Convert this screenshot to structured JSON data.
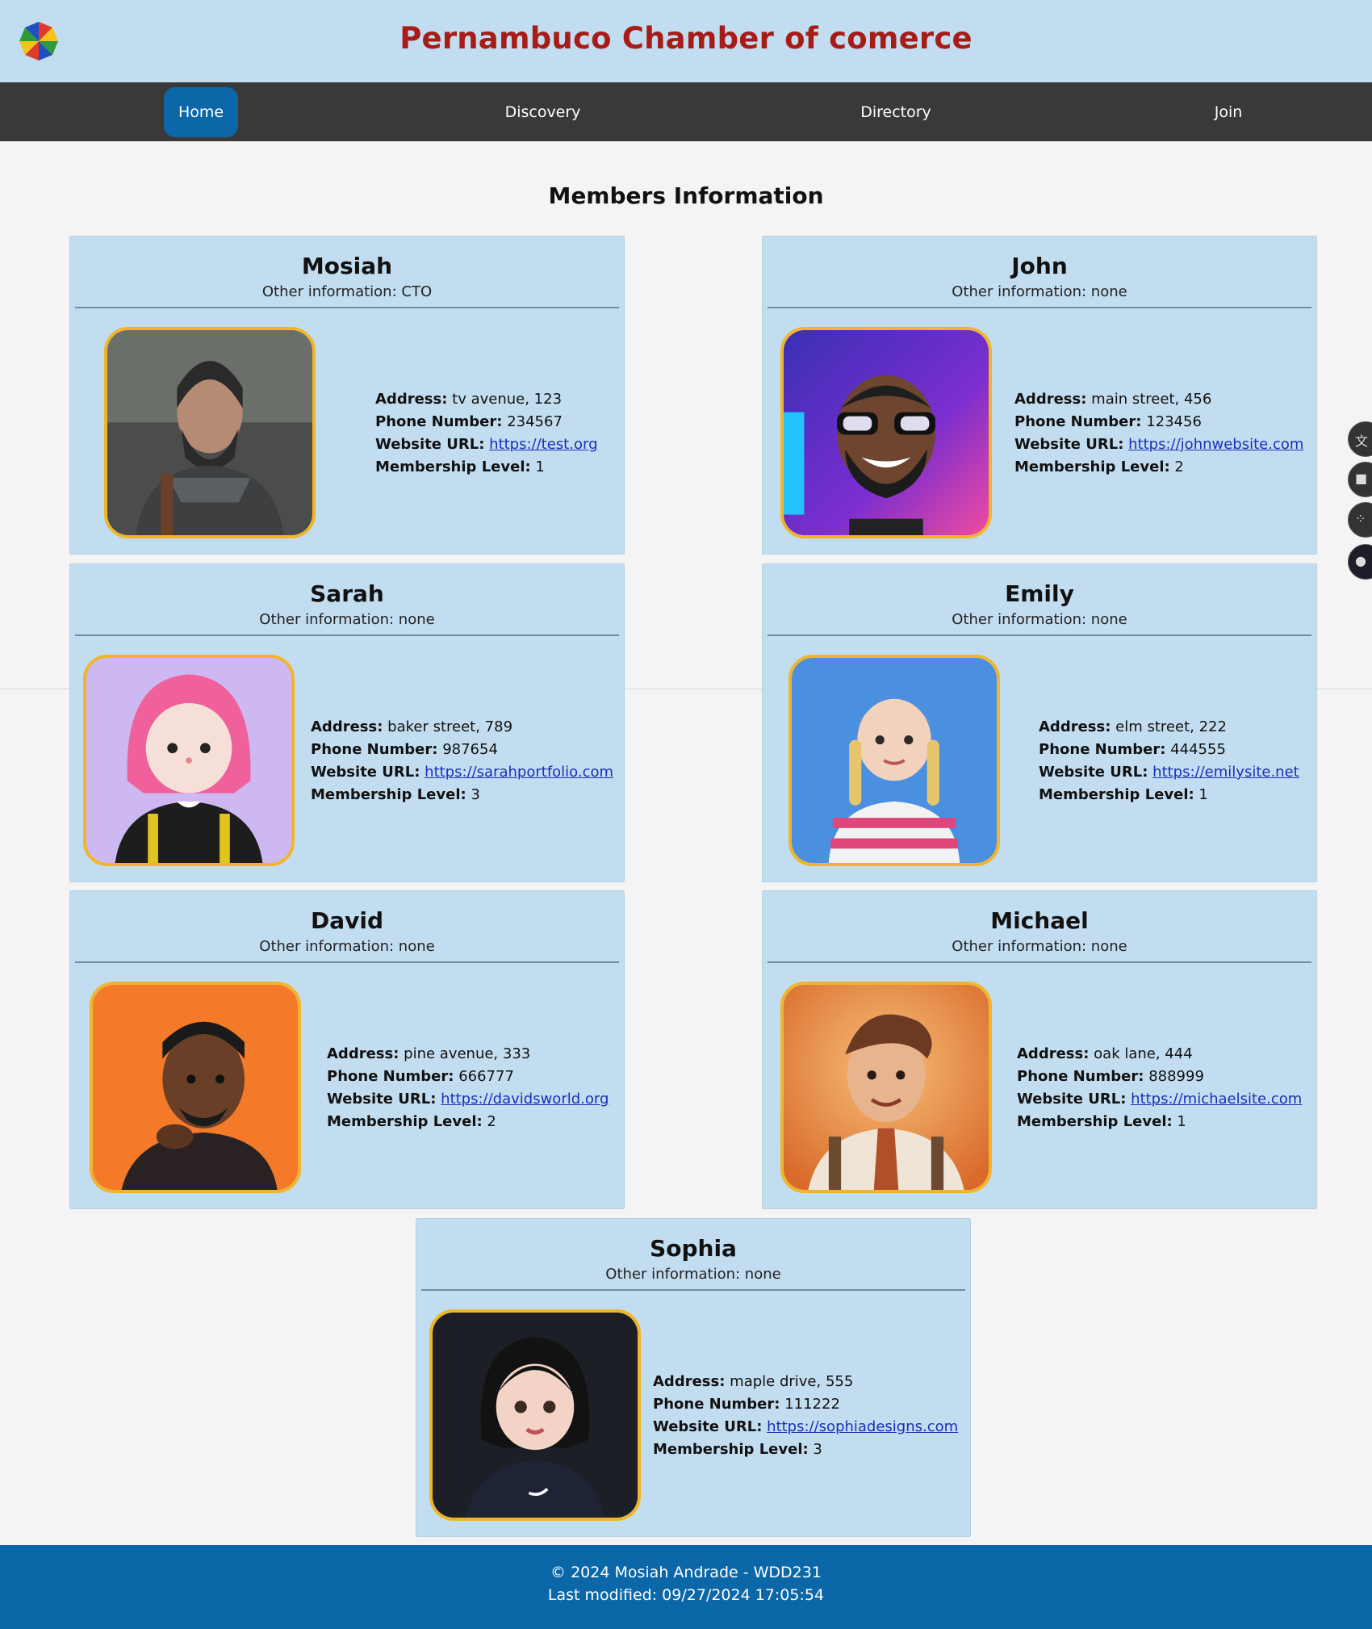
{
  "header": {
    "title": "Pernambuco Chamber of comerce",
    "logo_icon": "pinwheel-logo-icon"
  },
  "nav": {
    "items": [
      {
        "label": "Home",
        "active": true
      },
      {
        "label": "Discovery",
        "active": false
      },
      {
        "label": "Directory",
        "active": false
      },
      {
        "label": "Join",
        "active": false
      }
    ]
  },
  "main": {
    "heading": "Members Information",
    "field_labels": {
      "address": "Address:",
      "phone": "Phone Number:",
      "website": "Website URL:",
      "level": "Membership Level:"
    },
    "members": [
      {
        "name": "Mosiah",
        "other": "Other information: CTO",
        "address": "tv avenue, 123",
        "phone": "234567",
        "website": "https://test.org",
        "level": "1",
        "avatar_icon": "armored-warrior-avatar"
      },
      {
        "name": "John",
        "other": "Other information: none",
        "address": "main street, 456",
        "phone": "123456",
        "website": "https://johnwebsite.com",
        "level": "2",
        "avatar_icon": "bearded-man-glasses-avatar"
      },
      {
        "name": "Sarah",
        "other": "Other information: none",
        "address": "baker street, 789",
        "phone": "987654",
        "website": "https://sarahportfolio.com",
        "level": "3",
        "avatar_icon": "pink-hair-girl-avatar"
      },
      {
        "name": "Emily",
        "other": "Other information: none",
        "address": "elm street, 222",
        "phone": "444555",
        "website": "https://emilysite.net",
        "level": "1",
        "avatar_icon": "braided-girl-avatar"
      },
      {
        "name": "David",
        "other": "Other information: none",
        "address": "pine avenue, 333",
        "phone": "666777",
        "website": "https://davidsworld.org",
        "level": "2",
        "avatar_icon": "thinking-man-avatar"
      },
      {
        "name": "Michael",
        "other": "Other information: none",
        "address": "oak lane, 444",
        "phone": "888999",
        "website": "https://michaelsite.com",
        "level": "1",
        "avatar_icon": "smiling-man-tie-avatar"
      },
      {
        "name": "Sophia",
        "other": "Other information: none",
        "address": "maple drive, 555",
        "phone": "111222",
        "website": "https://sophiadesigns.com",
        "level": "3",
        "avatar_icon": "dark-hair-girl-avatar"
      }
    ]
  },
  "footer": {
    "line1": "© 2024 Mosiah Andrade - WDD231",
    "line2": "Last modified: 09/27/2024 17:05:54"
  },
  "colors": {
    "header_bg": "#c3ddf0",
    "title": "#a71c17",
    "nav_bg": "#393939",
    "accent": "#0b67a8",
    "card_bg": "#c3ddf0",
    "avatar_border": "#f0b52a",
    "link": "#1a2fb8"
  }
}
